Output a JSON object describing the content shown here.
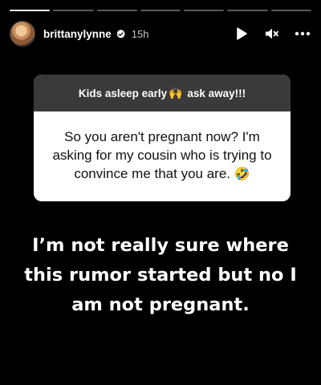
{
  "story": {
    "progress": {
      "total_segments": 7,
      "completed_segments": 1
    },
    "header": {
      "username": "brittanylynne",
      "verified": true,
      "time_ago": "15h",
      "controls": [
        "play-icon",
        "mute-icon",
        "more-icon"
      ]
    },
    "question_sticker": {
      "prompt_before": "Kids asleep early",
      "prompt_emoji": "🙌",
      "prompt_after": " ask away!!!",
      "question": "So you aren't pregnant now? I'm asking for my cousin who is trying to convince me that you are. ",
      "question_emoji": "🤣"
    },
    "answer_text": "I’m not really sure where this rumor started but no I am not pregnant."
  },
  "colors": {
    "background": "#000000",
    "sticker_header": "#3a3a3c",
    "sticker_body": "#ffffff",
    "verified_badge": "#ffffff"
  }
}
